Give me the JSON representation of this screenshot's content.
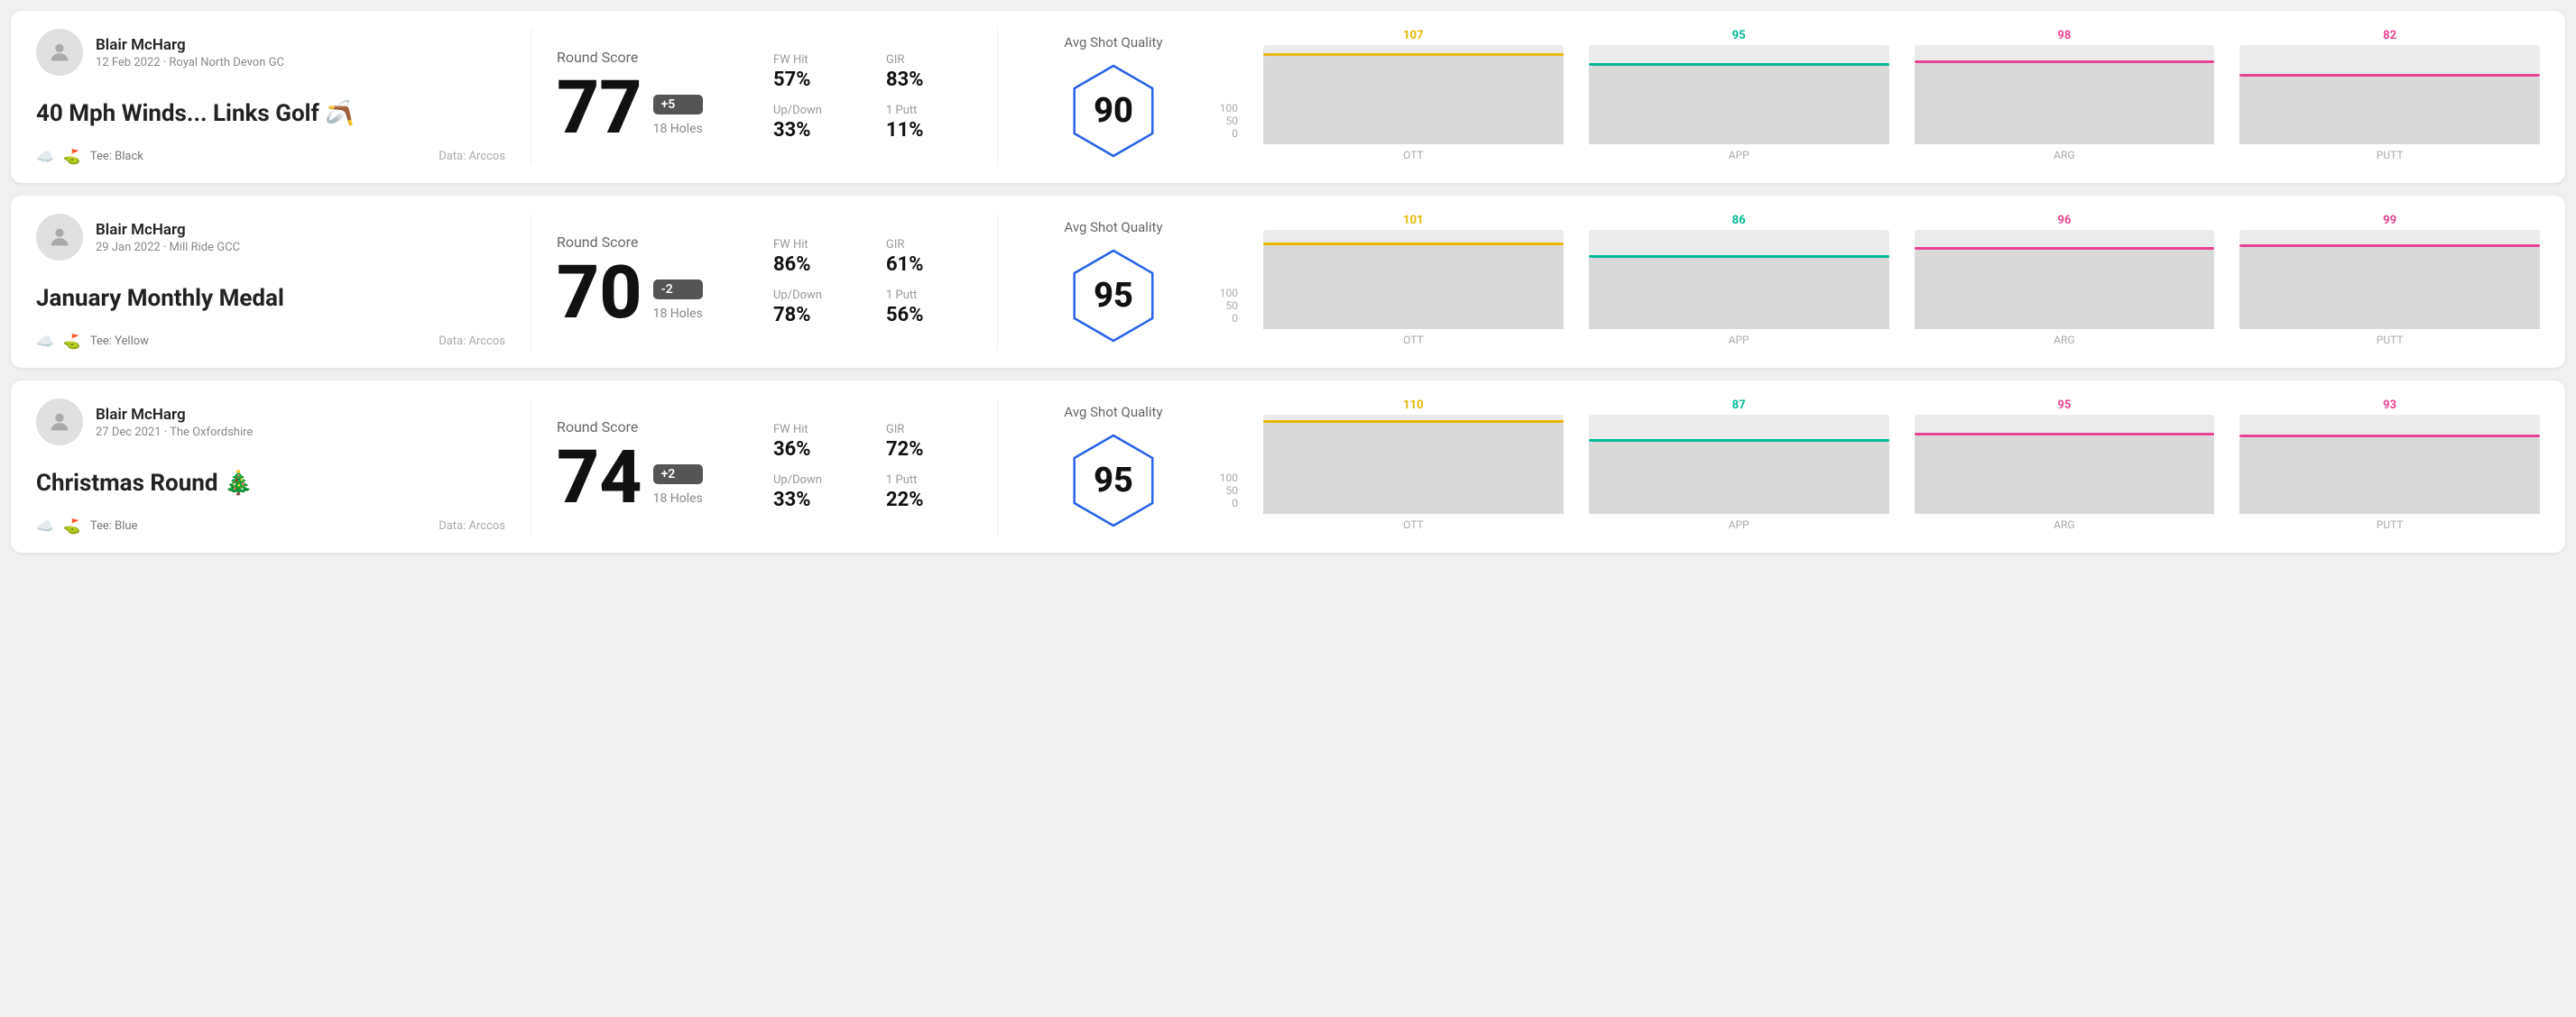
{
  "rounds": [
    {
      "id": "round1",
      "userName": "Blair McHarg",
      "userDate": "12 Feb 2022 · Royal North Devon GC",
      "roundTitle": "40 Mph Winds... Links Golf 🪃",
      "tee": "Black",
      "dataSource": "Data: Arccos",
      "score": "77",
      "scoreBadge": "+5",
      "scoreHoles": "18 Holes",
      "fwHit": "57%",
      "gir": "83%",
      "upDown": "33%",
      "onePutt": "11%",
      "avgQuality": "90",
      "chartBars": [
        {
          "label": "OTT",
          "value": 107,
          "color": "#e6b800"
        },
        {
          "label": "APP",
          "value": 95,
          "color": "#00b894"
        },
        {
          "label": "ARG",
          "value": 98,
          "color": "#e84393"
        },
        {
          "label": "PUTT",
          "value": 82,
          "color": "#e84393"
        }
      ]
    },
    {
      "id": "round2",
      "userName": "Blair McHarg",
      "userDate": "29 Jan 2022 · Mill Ride GCC",
      "roundTitle": "January Monthly Medal",
      "tee": "Yellow",
      "dataSource": "Data: Arccos",
      "score": "70",
      "scoreBadge": "-2",
      "scoreHoles": "18 Holes",
      "fwHit": "86%",
      "gir": "61%",
      "upDown": "78%",
      "onePutt": "56%",
      "avgQuality": "95",
      "chartBars": [
        {
          "label": "OTT",
          "value": 101,
          "color": "#e6b800"
        },
        {
          "label": "APP",
          "value": 86,
          "color": "#00b894"
        },
        {
          "label": "ARG",
          "value": 96,
          "color": "#e84393"
        },
        {
          "label": "PUTT",
          "value": 99,
          "color": "#e84393"
        }
      ]
    },
    {
      "id": "round3",
      "userName": "Blair McHarg",
      "userDate": "27 Dec 2021 · The Oxfordshire",
      "roundTitle": "Christmas Round 🎄",
      "tee": "Blue",
      "dataSource": "Data: Arccos",
      "score": "74",
      "scoreBadge": "+2",
      "scoreHoles": "18 Holes",
      "fwHit": "36%",
      "gir": "72%",
      "upDown": "33%",
      "onePutt": "22%",
      "avgQuality": "95",
      "chartBars": [
        {
          "label": "OTT",
          "value": 110,
          "color": "#e6b800"
        },
        {
          "label": "APP",
          "value": 87,
          "color": "#00b894"
        },
        {
          "label": "ARG",
          "value": 95,
          "color": "#e84393"
        },
        {
          "label": "PUTT",
          "value": 93,
          "color": "#e84393"
        }
      ]
    }
  ],
  "labels": {
    "roundScore": "Round Score",
    "fwHit": "FW Hit",
    "gir": "GIR",
    "upDown": "Up/Down",
    "onePutt": "1 Putt",
    "avgShotQuality": "Avg Shot Quality",
    "data": "Data: Arccos",
    "teePrefix": "Tee:",
    "yAxis100": "100",
    "yAxis50": "50",
    "yAxis0": "0"
  }
}
